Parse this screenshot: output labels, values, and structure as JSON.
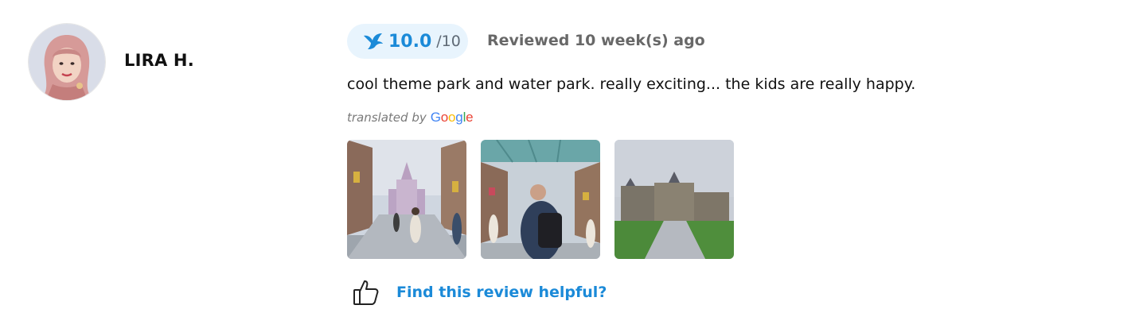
{
  "reviewer": {
    "name": "LIRA H.",
    "avatar_icon": "reviewer-avatar"
  },
  "rating": {
    "score": "10.0",
    "max": "/10",
    "icon": "bird-icon",
    "color": "#1b8ad8",
    "badge_bg": "#e8f4fd"
  },
  "review": {
    "time": "Reviewed 10 week(s) ago",
    "text": "cool theme park and water park. really exciting... the kids are really happy.",
    "translated_by": "translated by",
    "translator_logo": "Google"
  },
  "photos": [
    {
      "name": "review-photo-1"
    },
    {
      "name": "review-photo-2"
    },
    {
      "name": "review-photo-3"
    }
  ],
  "helpful": {
    "label": "Find this review helpful?",
    "icon": "thumbs-up-icon"
  }
}
